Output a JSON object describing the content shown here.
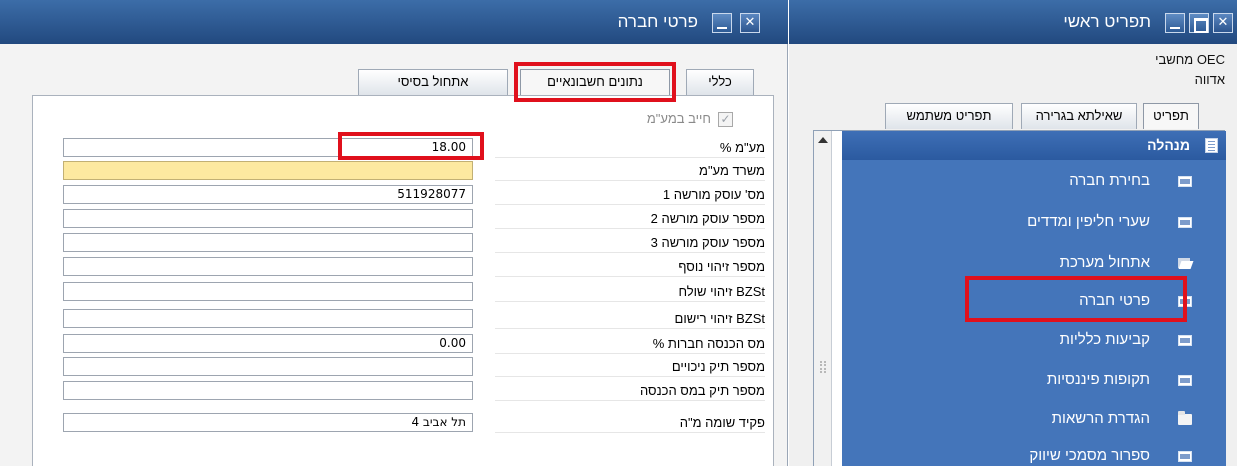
{
  "details_window": {
    "title": "פרטי חברה",
    "tabs": [
      {
        "label": "כללי"
      },
      {
        "label": "נתונים חשבונאיים"
      },
      {
        "label": "אתחול בסיסי"
      }
    ],
    "vat_liable_label": "חייב במע\"מ",
    "fields": [
      {
        "label": "% מע\"מ",
        "value": "18.00"
      },
      {
        "label": "משרד מע\"מ",
        "value": ""
      },
      {
        "label": "מס' עוסק מורשה 1",
        "value": "511928077"
      },
      {
        "label": "מספר עוסק מורשה 2",
        "value": ""
      },
      {
        "label": "מספר עוסק מורשה 3",
        "value": ""
      },
      {
        "label": "מספר זיהוי נוסף",
        "value": ""
      },
      {
        "label": "זיהוי שולח BZSt",
        "value": ""
      },
      {
        "label": "זיהוי רישום BZSt",
        "value": ""
      },
      {
        "label": "% מס הכנסה חברות",
        "value": "0.00"
      },
      {
        "label": "מספר תיק ניכויים",
        "value": ""
      },
      {
        "label": "מספר תיק במס הכנסה",
        "value": ""
      },
      {
        "label": "פקיד שומה מ\"ה",
        "value": "תל אביב 4"
      }
    ]
  },
  "menu_window": {
    "title": "תפריט ראשי",
    "info_line1": "מחשבי OEC",
    "info_line2": "אדווה",
    "tabs": [
      {
        "label": "תפריט"
      },
      {
        "label": "שאילתא בגרירה"
      },
      {
        "label": "תפריט משתמש"
      }
    ],
    "section_header": "מנהלה",
    "items": [
      {
        "label": "בחירת חברה",
        "icon": "form-icon"
      },
      {
        "label": "שערי חליפין ומדדים",
        "icon": "form-icon"
      },
      {
        "label": "אתחול מערכת",
        "icon": "folder-open-icon"
      },
      {
        "label": "פרטי חברה",
        "icon": "form-icon"
      },
      {
        "label": "קביעות כלליות",
        "icon": "form-icon"
      },
      {
        "label": "תקופות פיננסיות",
        "icon": "form-icon"
      },
      {
        "label": "הגדרת הרשאות",
        "icon": "folder-icon"
      },
      {
        "label": "ספרור מסמכי שיווק",
        "icon": "form-icon"
      }
    ]
  },
  "colors": {
    "titlebar": "#2d5a95",
    "menu_background": "#4475ba",
    "highlight": "#e0101c",
    "required_field": "#fde9a0"
  }
}
